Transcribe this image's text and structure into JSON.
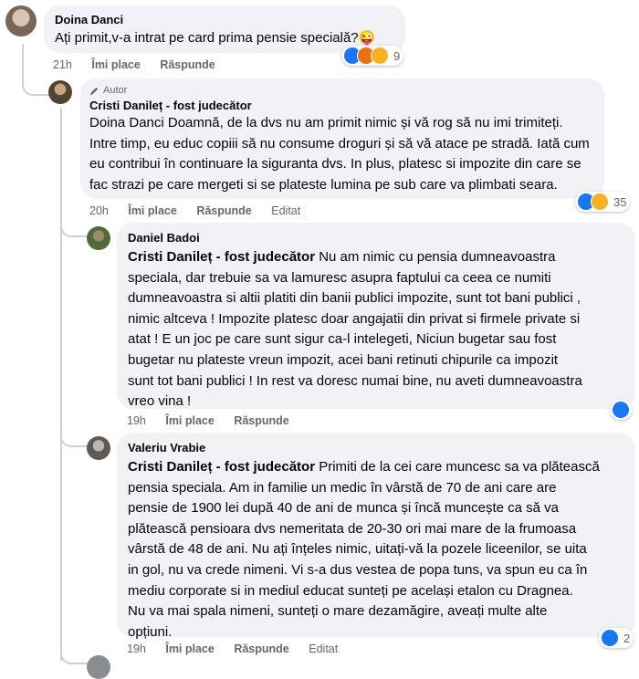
{
  "comments": [
    {
      "name": "Doina Danci",
      "text": "Ați primit,v-a intrat pe card prima pensie specială?😜",
      "time": "21h",
      "like": "Îmi place",
      "reply": "Răspunde",
      "reactions": {
        "icons": [
          "like",
          "angry",
          "haha"
        ],
        "count": "9"
      }
    },
    {
      "badge": "Autor",
      "name": "Cristi Danileț - fost judecător",
      "lines": [
        "Doina Danci Doamnă, de la dvs nu am primit nimic și vă rog să nu imi trimiteți.",
        "Intre timp, eu educ copiii să nu consume droguri și să vă atace pe stradă. Iată cum",
        "eu contribui în continuare la siguranta dvs. In plus, platesc si impozite din care se",
        "fac strazi pe care mergeti si se plateste lumina pe sub care va plimbati seara."
      ],
      "time": "20h",
      "like": "Îmi place",
      "reply": "Răspunde",
      "edited": "Editat",
      "reactions": {
        "icons": [
          "like",
          "haha"
        ],
        "count": "35"
      }
    },
    {
      "name": "Daniel Badoi",
      "tag": "Cristi Danileț - fost judecător",
      "lines": [
        "Nu am nimic cu pensia dumneavoastra",
        "speciala, dar trebuie sa va lamuresc asupra faptului ca ceea ce numiti",
        "dumneavoastra si altii platiti din banii publici impozite, sunt tot bani publici ,",
        "nimic altceva ! Impozite platesc doar angajatii din privat si firmele private si",
        "atat ! E un joc pe care sunt sigur ca-l intelegeti, Niciun bugetar sau fost",
        "bugetar nu plateste vreun impozit, acei bani retinuti chipurile ca impozit",
        "sunt tot bani publici ! In rest va doresc numai bine, nu aveti dumneavoastra",
        "vreo vina !"
      ],
      "time": "19h",
      "like": "Îmi place",
      "reply": "Răspunde",
      "reactions": {
        "icons": [
          "like"
        ],
        "count": ""
      }
    },
    {
      "name": "Valeriu Vrabie",
      "tag": "Cristi Danileț - fost judecător",
      "lines": [
        "Primiti de la cei care muncesc sa va plătească",
        "pensia speciala. Am in familie un medic în vârstă de 70 de ani care are",
        "pensie de 1900 lei după 40 de ani de munca și încă muncește ca să va",
        "plătească pensioara dvs nemeritata de 20-30 ori mai mare de la frumoasa",
        "vârstă de 48 de ani. Nu ați înțeles nimic, uitați-vă la pozele liceenilor, se uita",
        "in gol, nu va crede nimeni. Vi s-a dus vestea de popa tuns, va spun eu ca în",
        "mediu corporate si in mediul educat sunteți pe același etalon cu Dragnea.",
        "Nu va mai spala nimeni, sunteți o mare dezamăgire, aveați multe alte",
        "opțiuni."
      ],
      "time": "19h",
      "like": "Îmi place",
      "reply": "Răspunde",
      "edited": "Editat",
      "reactions": {
        "icons": [
          "like"
        ],
        "count": "2"
      }
    }
  ],
  "colors": {
    "like": "#1877f2",
    "haha": "#f7b125",
    "angry": "#e9710f",
    "bubble": "#f0f2f5",
    "meta": "#65676b"
  }
}
